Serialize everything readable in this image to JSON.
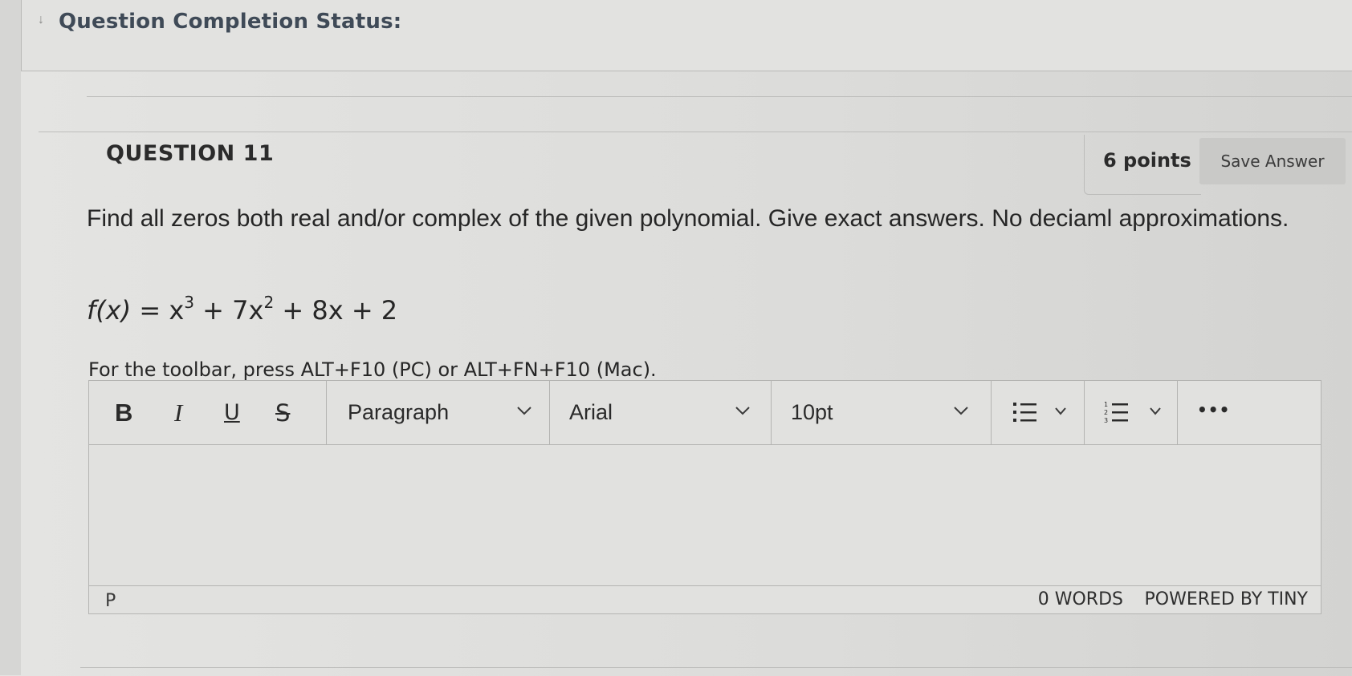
{
  "status_panel": {
    "title": "Question Completion Status:"
  },
  "question": {
    "title": "QUESTION 11",
    "points": "6 points",
    "save_label": "Save Answer",
    "prompt": "Find all zeros both real and/or complex of the given polynomial. Give exact answers. No deciaml approximations.",
    "formula": {
      "lhs": "f(x) = ",
      "t1": "x",
      "e1": "3",
      "t2": " + 7x",
      "e2": "2",
      "t3": " + 8x + 2"
    }
  },
  "editor": {
    "hint": "For the toolbar, press ALT+F10 (PC) or ALT+FN+F10 (Mac).",
    "toolbar": {
      "bold": "B",
      "italic": "I",
      "underline": "U",
      "strike": "S",
      "block_format": "Paragraph",
      "font_family": "Arial",
      "font_size": "10pt",
      "more": "•••"
    },
    "path": "P",
    "word_count": "0 WORDS",
    "brand": "POWERED BY TINY"
  },
  "icons": {
    "collapse": "chevron-down-double-icon",
    "bullet_list": "bullet-list-icon",
    "numbered_list": "numbered-list-icon",
    "dropdown": "chevron-down-icon",
    "more": "more-icon"
  },
  "colors": {
    "status_title": "#3f4a57",
    "save_button_bg": "#c9c9c7",
    "background": "#dedede"
  }
}
